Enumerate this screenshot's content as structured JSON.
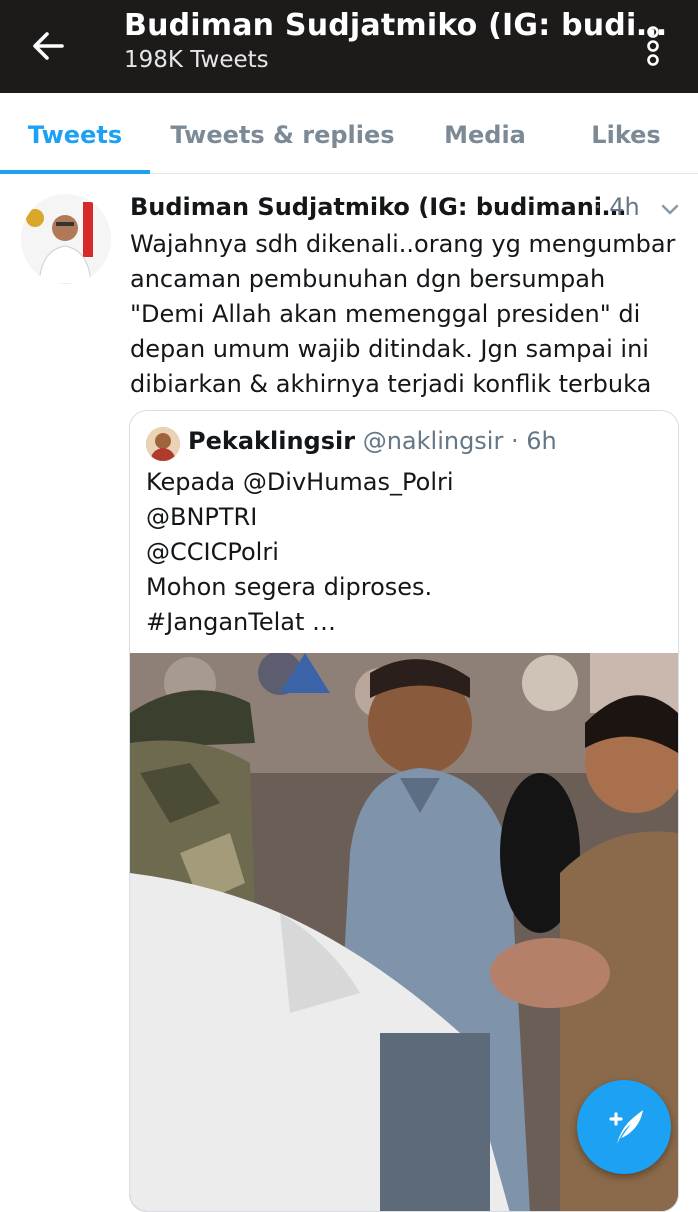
{
  "header": {
    "title": "Budiman Sudjatmiko (IG: budi…",
    "subtitle": "198K Tweets",
    "back_icon": "arrow-left-icon",
    "more_icon": "more-vertical-icon"
  },
  "tabs": [
    {
      "label": "Tweets",
      "active": true
    },
    {
      "label": "Tweets & replies",
      "active": false
    },
    {
      "label": "Media",
      "active": false
    },
    {
      "label": "Likes",
      "active": false
    }
  ],
  "tweet": {
    "author": "Budiman Sudjatmiko (IG: budimani…",
    "time": "· 4h",
    "text_lines": [
      "Wajahnya sdh dikenali..orang yg mengumbar",
      "ancaman pembunuhan dgn bersumpah",
      "\"Demi Allah akan memenggal presiden\" di",
      "depan umum wajib ditindak. Jgn sampai ini",
      "dibiarkan & akhirnya terjadi konflik terbuka"
    ],
    "quote": {
      "name": "Pekaklingsir",
      "handle": "@naklingsir · 6h",
      "text_lines": [
        "Kepada @DivHumas_Polri",
        "@BNPTRI",
        "@CCICPolri",
        "Mohon segera diproses.",
        "#JanganTelat …"
      ]
    }
  },
  "colors": {
    "accent": "#1da1f2",
    "header_bg": "#1d1a1a",
    "muted": "#657786"
  },
  "fab": {
    "icon": "compose-tweet-icon"
  }
}
